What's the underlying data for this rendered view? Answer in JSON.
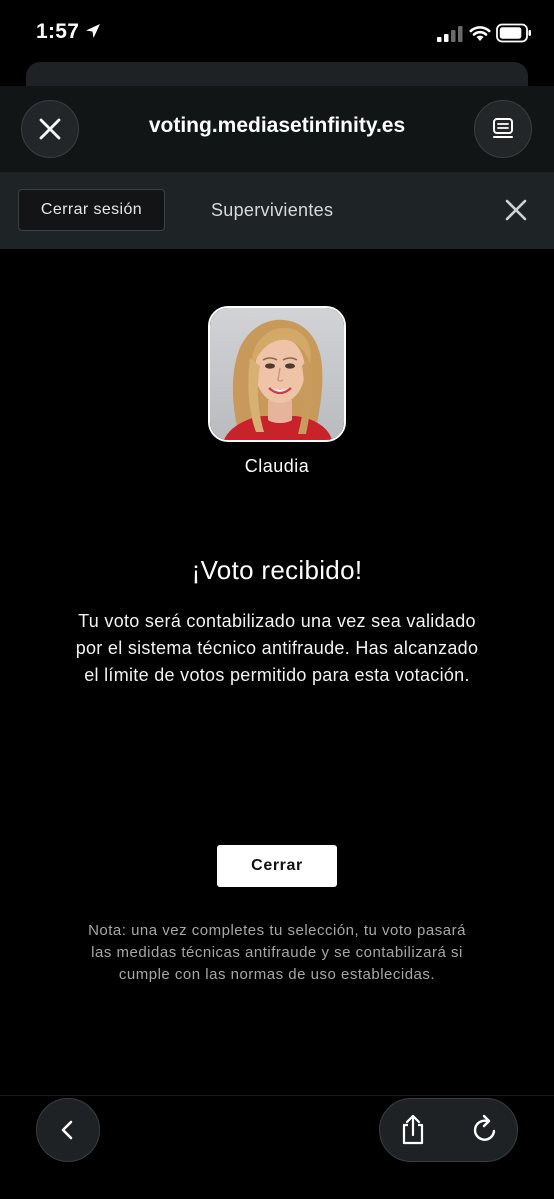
{
  "status_bar": {
    "time": "1:57"
  },
  "browser": {
    "url": "voting.mediasetinfinity.es"
  },
  "toolbar": {
    "logout_label": "Cerrar sesión",
    "show_title": "Supervivientes"
  },
  "candidate": {
    "name": "Claudia"
  },
  "result": {
    "headline": "¡Voto recibido!",
    "message": "Tu voto será contabilizado una vez sea validado por el sistema técnico antifraude. Has alcanzado el límite de votos permitido para esta votación.",
    "close_label": "Cerrar",
    "note": "Nota: una vez completes tu selección, tu voto pasará las medidas técnicas antifraude y se contabilizará si cumple con las normas de uso establecidas."
  },
  "colors": {
    "background": "#000000",
    "toolbar": "#1e2326",
    "primary_button": "#ffffff"
  }
}
